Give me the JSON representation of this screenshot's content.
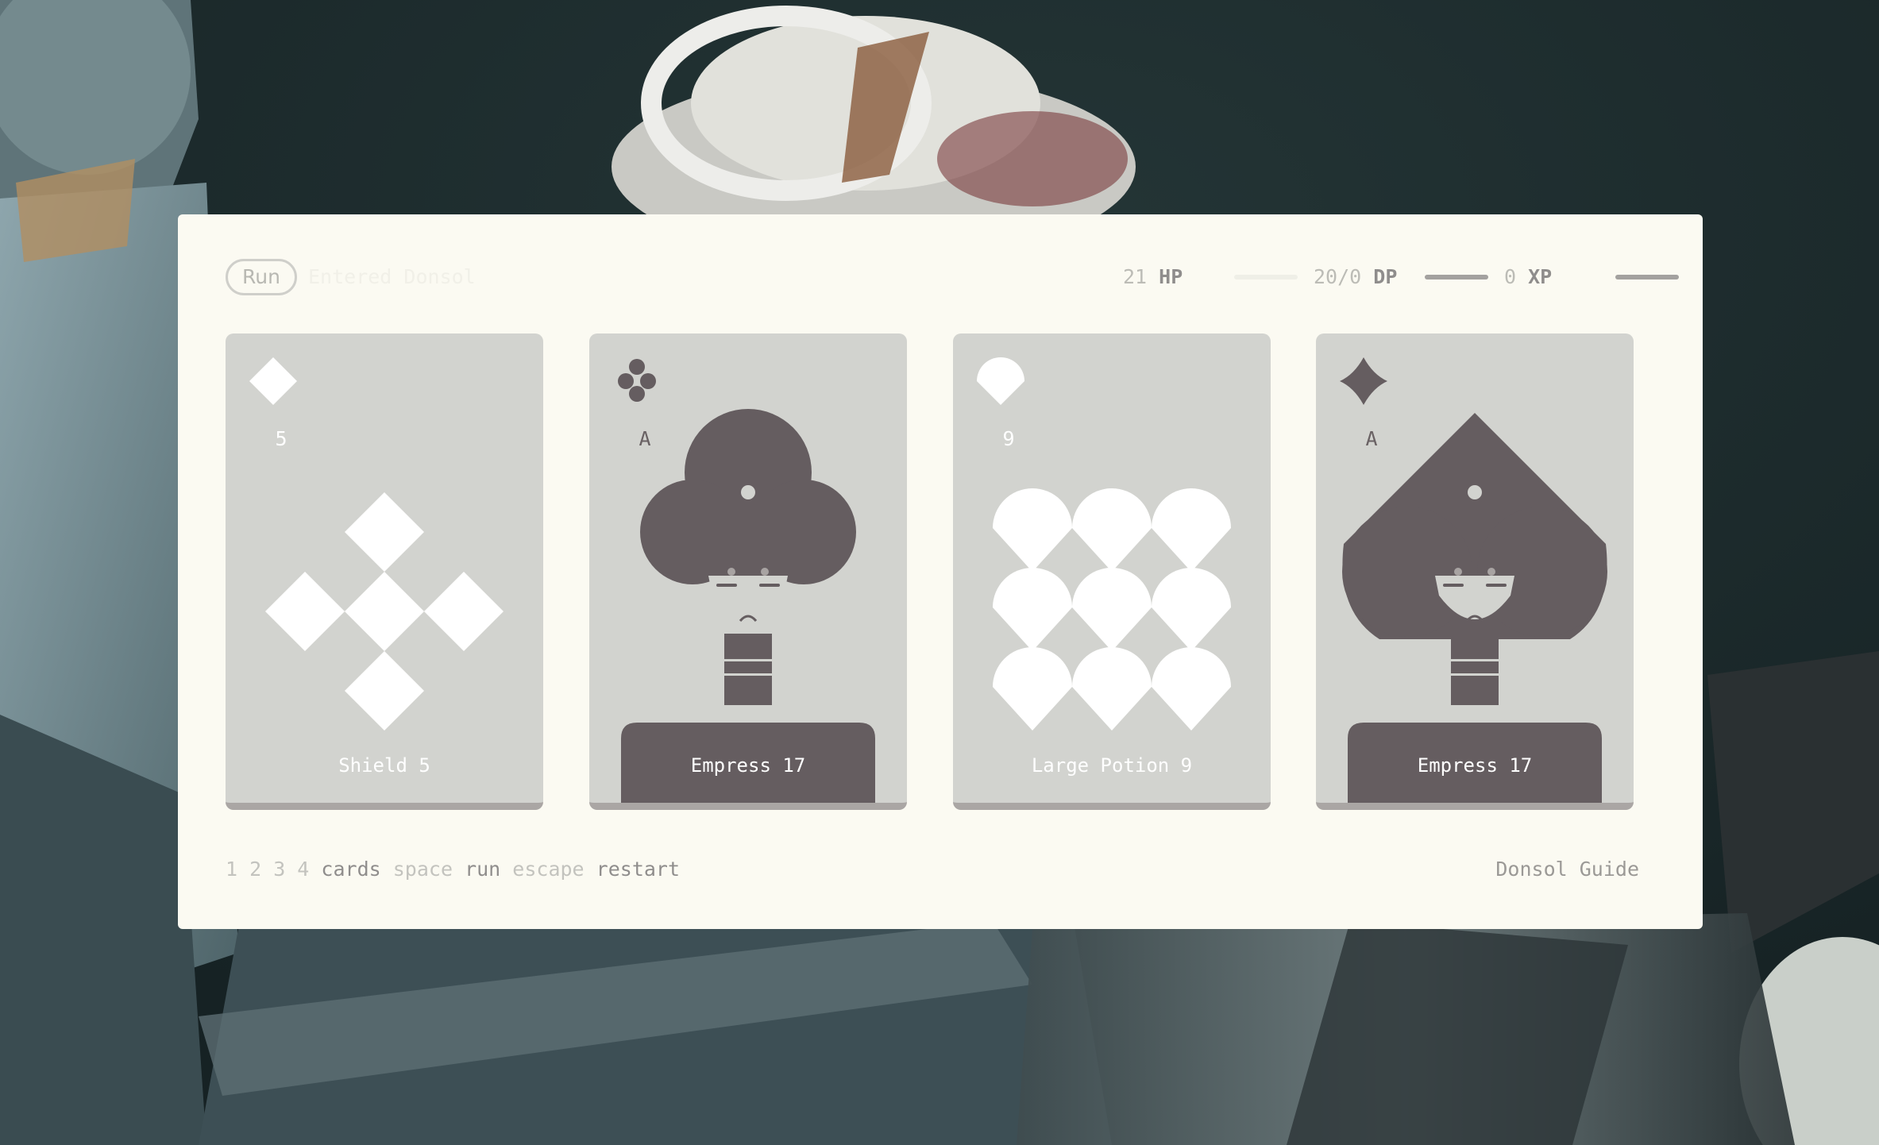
{
  "status": {
    "run_label": "Run",
    "message": "Entered Donsol"
  },
  "stats": {
    "hp": {
      "value": "21",
      "unit": "HP",
      "fill": 0
    },
    "dp": {
      "value": "20/0",
      "unit": "DP",
      "fill": 1
    },
    "xp": {
      "value": "0",
      "unit": "XP",
      "fill": 1
    }
  },
  "cards": [
    {
      "suit": "diamond",
      "value": "5",
      "name": "Shield 5"
    },
    {
      "suit": "club",
      "value": "A",
      "name": "Empress 17"
    },
    {
      "suit": "heart",
      "value": "9",
      "name": "Large Potion 9"
    },
    {
      "suit": "spade",
      "value": "A",
      "name": "Empress 17"
    }
  ],
  "hints": {
    "keys_cards": "1 2 3 4",
    "cards": "cards",
    "key_space": "space",
    "run": "run",
    "key_escape": "escape",
    "restart": "restart"
  },
  "guide_label": "Donsol Guide",
  "colors": {
    "panel": "#fbfaf2",
    "card": "#d2d3cf",
    "ink": "#655d60",
    "white": "#ffffff"
  }
}
